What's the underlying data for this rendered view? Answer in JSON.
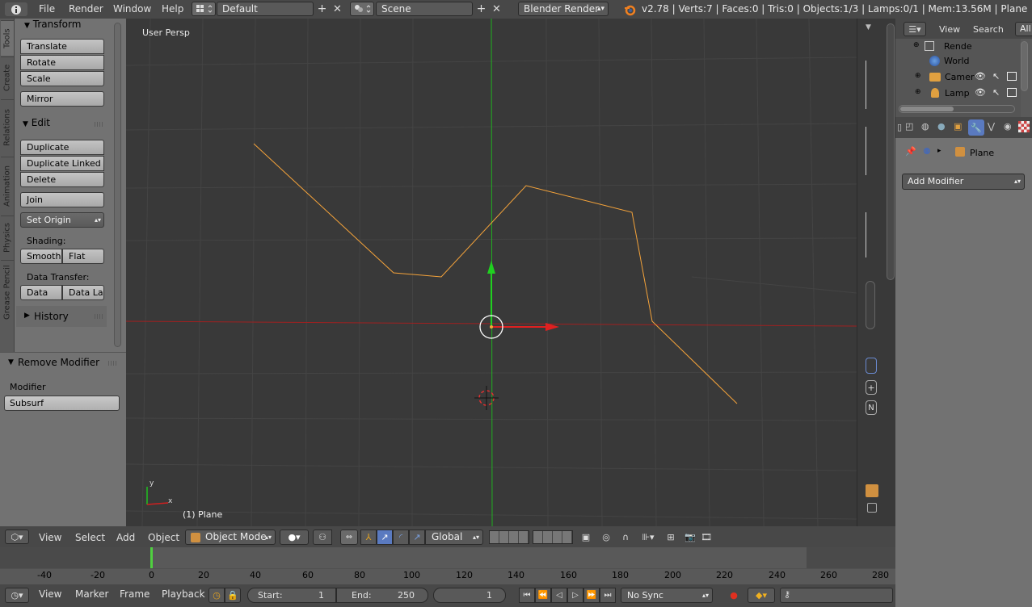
{
  "topbar": {
    "menus": [
      "File",
      "Render",
      "Window",
      "Help"
    ],
    "screen_layout": "Default",
    "scene": "Scene",
    "render_engine": "Blender Render",
    "stats": "v2.78 | Verts:7 | Faces:0 | Tris:0 | Objects:1/3 | Lamps:0/1 | Mem:13.56M | Plane"
  },
  "tool_tabs": [
    "Tools",
    "Create",
    "Relations",
    "Animation",
    "Physics",
    "Grease Pencil"
  ],
  "tools": {
    "transform_title": "Transform",
    "transform_buttons": [
      "Translate",
      "Rotate",
      "Scale"
    ],
    "mirror": "Mirror",
    "edit_title": "Edit",
    "edit_buttons": [
      "Duplicate",
      "Duplicate Linked",
      "Delete"
    ],
    "join": "Join",
    "set_origin": "Set Origin",
    "shading_label": "Shading:",
    "smooth": "Smooth",
    "flat": "Flat",
    "data_transfer_label": "Data Transfer:",
    "data": "Data",
    "data_la": "Data La",
    "history": "History"
  },
  "redo_panel": {
    "title": "Remove Modifier",
    "modifier_label": "Modifier",
    "modifier_value": "Subsurf"
  },
  "viewport": {
    "view_name": "User Persp",
    "object_label": "(1) Plane"
  },
  "viewport_header": {
    "menus": [
      "View",
      "Select",
      "Add",
      "Object"
    ],
    "mode": "Object Mode",
    "orientation": "Global"
  },
  "timeline": {
    "ticks": [
      "-40",
      "-20",
      "0",
      "20",
      "40",
      "60",
      "80",
      "100",
      "120",
      "140",
      "160",
      "180",
      "200",
      "220",
      "240",
      "260",
      "280"
    ],
    "menus": [
      "View",
      "Marker",
      "Frame",
      "Playback"
    ],
    "start_label": "Start:",
    "start_value": "1",
    "end_label": "End:",
    "end_value": "250",
    "current_frame": "1",
    "sync": "No Sync"
  },
  "outliner": {
    "view": "View",
    "search": "Search",
    "filter": "All",
    "items": [
      "Rende",
      "World",
      "Camer",
      "Lamp"
    ]
  },
  "properties": {
    "object_name": "Plane",
    "add_modifier": "Add Modifier"
  },
  "colors": {
    "curve": "#f5a33a",
    "x_axis": "#c02020",
    "y_axis": "#20c020"
  }
}
